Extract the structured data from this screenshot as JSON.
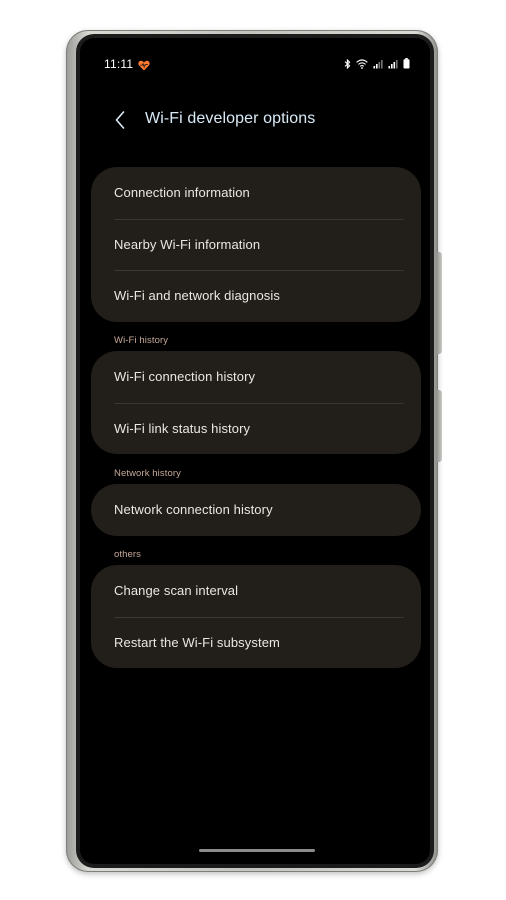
{
  "status_bar": {
    "time": "11:11",
    "icons": [
      "heart-notification-icon",
      "bluetooth-icon",
      "wifi-icon",
      "signal-icon",
      "signal-icon",
      "battery-icon"
    ]
  },
  "header": {
    "back_icon": "chevron-left-icon",
    "title": "Wi-Fi developer options"
  },
  "groups": {
    "main": {
      "items": [
        {
          "label": "Connection information"
        },
        {
          "label": "Nearby Wi-Fi information"
        },
        {
          "label": "Wi-Fi and network diagnosis"
        }
      ]
    },
    "wifi_history": {
      "title": "Wi-Fi history",
      "items": [
        {
          "label": "Wi-Fi connection history"
        },
        {
          "label": "Wi-Fi link status history"
        }
      ]
    },
    "network_history": {
      "title": "Network history",
      "items": [
        {
          "label": "Network connection history"
        }
      ]
    },
    "others": {
      "title": "others",
      "items": [
        {
          "label": "Change scan interval"
        },
        {
          "label": "Restart the Wi-Fi subsystem"
        }
      ]
    }
  },
  "colors": {
    "screen_bg": "#000000",
    "card_bg": "#221f1b",
    "title_text": "#d9eaf7",
    "item_text": "#ebe7e1",
    "section_label": "#c6a998",
    "divider": "#3a3632"
  }
}
